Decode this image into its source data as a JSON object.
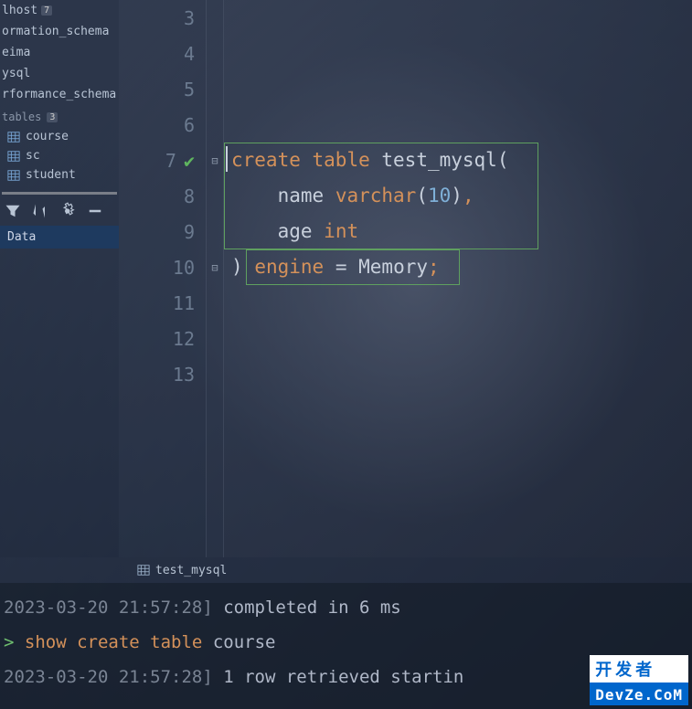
{
  "sidebar": {
    "databases": [
      {
        "name": "lhost",
        "badge": "7"
      },
      {
        "name": "ormation_schema"
      },
      {
        "name": "eima"
      },
      {
        "name": "ysql"
      },
      {
        "name": "rformance_schema"
      }
    ],
    "tables_label": "tables",
    "tables_count": "3",
    "tables": [
      "course",
      "sc",
      "student"
    ],
    "data_tab": "Data"
  },
  "editor": {
    "lines": [
      {
        "num": "3"
      },
      {
        "num": "4"
      },
      {
        "num": "5"
      },
      {
        "num": "6"
      },
      {
        "num": "7"
      },
      {
        "num": "8"
      },
      {
        "num": "9"
      },
      {
        "num": "10"
      },
      {
        "num": "11"
      },
      {
        "num": "12"
      },
      {
        "num": "13"
      }
    ],
    "tokens": {
      "create": "create",
      "table": "table",
      "tablename": "test_mysql",
      "col1": "name",
      "varchar": "varchar",
      "ten": "10",
      "col2": "age",
      "int": "int",
      "engine": "engine",
      "memory": "Memory"
    }
  },
  "bottom_tab": "test_mysql",
  "console": {
    "lines": [
      {
        "ts": "2023-03-20 21:57:28]",
        "msg": "completed in 6 ms"
      },
      {
        "prompt": ">",
        "cmd_kw": "show create table",
        "cmd_rest": "course"
      },
      {
        "ts": "2023-03-20 21:57:28]",
        "msg": "1 row retrieved startin"
      }
    ]
  },
  "watermark": {
    "top": "开发者",
    "bottom": "DevZe.CoM"
  }
}
